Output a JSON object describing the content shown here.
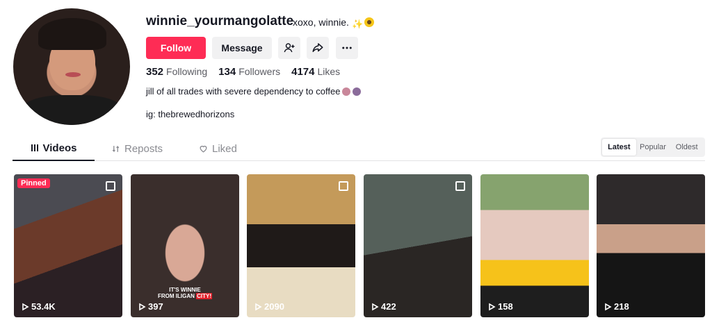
{
  "profile": {
    "username": "winnie_yourmangolatte",
    "nickname": "xoxo, winnie.",
    "follow_label": "Follow",
    "message_label": "Message",
    "stats": {
      "following_count": "352",
      "following_label": "Following",
      "followers_count": "134",
      "followers_label": "Followers",
      "likes_count": "4174",
      "likes_label": "Likes"
    },
    "bio_line1": "jill of all trades with severe dependency to coffee",
    "bio_line2": "ig: thebrewedhorizons"
  },
  "tabs": {
    "videos": "Videos",
    "reposts": "Reposts",
    "liked": "Liked"
  },
  "sort": {
    "latest": "Latest",
    "popular": "Popular",
    "oldest": "Oldest",
    "selected": "Latest"
  },
  "videos": [
    {
      "views": "53.4K",
      "pinned_label": "Pinned",
      "is_photo": true
    },
    {
      "views": "397",
      "caption_line1": "IT'S WINNIE",
      "caption_line2_a": "FROM ILIGAN ",
      "caption_line2_b": "CITY!"
    },
    {
      "views": "2090",
      "is_photo": true
    },
    {
      "views": "422",
      "is_photo": true
    },
    {
      "views": "158"
    },
    {
      "views": "218"
    }
  ],
  "icons": {
    "add_user": "add-user-icon",
    "share": "share-icon",
    "more": "more-icon",
    "videos_tab": "grid-icon",
    "reposts_tab": "repost-icon",
    "liked_tab": "heart-icon",
    "play": "play-icon",
    "photo": "photo-icon"
  },
  "colors": {
    "brand": "#fe2c55",
    "text": "#161823",
    "muted": "#8a8b91",
    "button_bg": "#f1f1f2"
  }
}
